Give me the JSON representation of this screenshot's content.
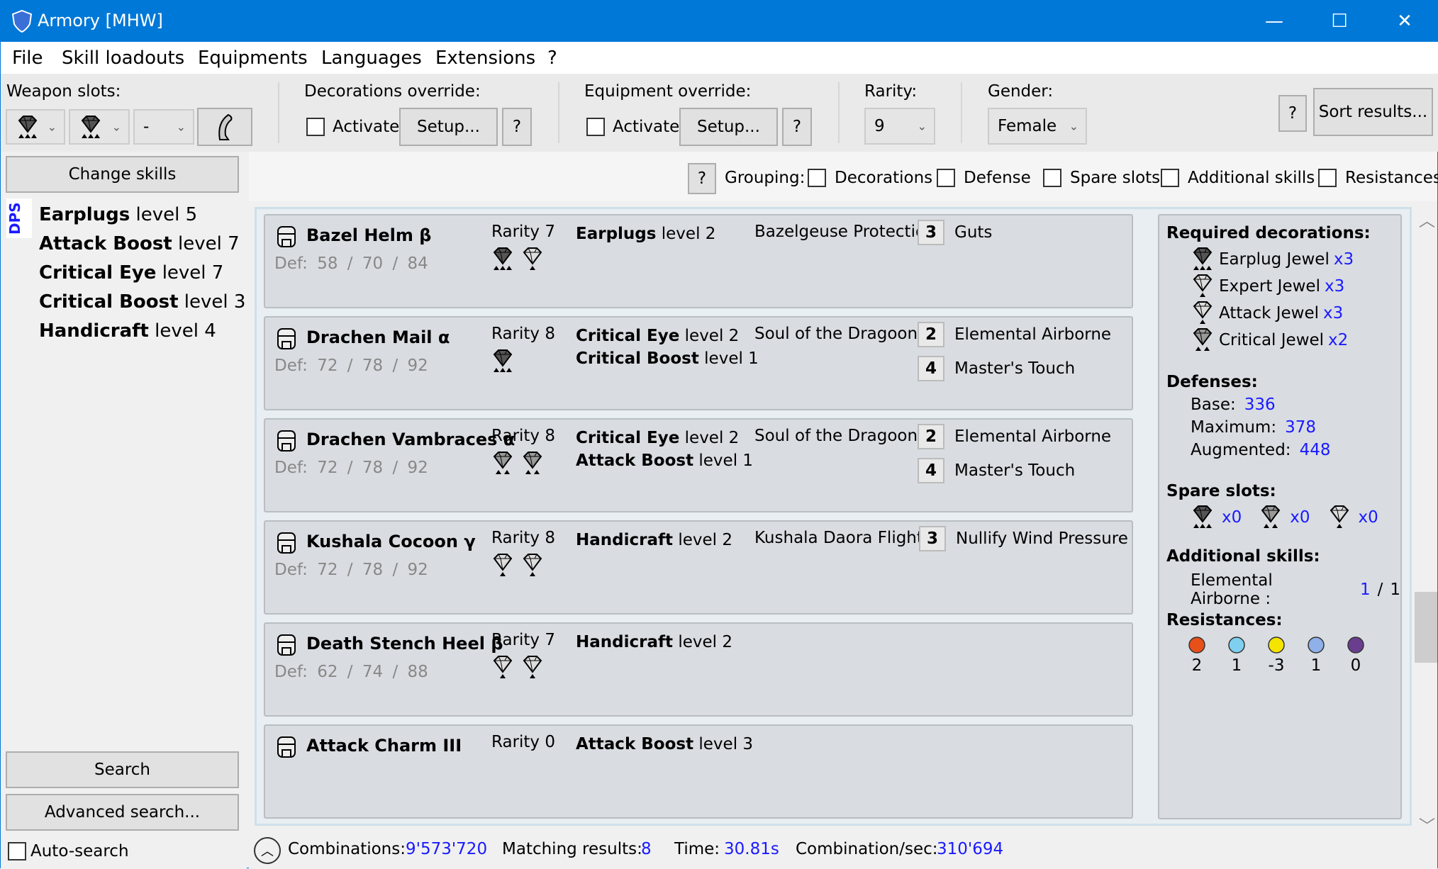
{
  "window": {
    "title": "Armory [MHW]",
    "minimize": "—",
    "maximize": "☐",
    "close": "✕"
  },
  "menu": [
    "File",
    "Skill loadouts",
    "Equipments",
    "Languages",
    "Extensions",
    "?"
  ],
  "toolbar": {
    "weapon_slots_label": "Weapon slots:",
    "weapon_slots": [
      "gem-3",
      "gem-3",
      "-"
    ],
    "decorations_override_label": "Decorations override:",
    "activate_label": "Activate",
    "setup_label": "Setup...",
    "help_label": "?",
    "equipment_override_label": "Equipment override:",
    "rarity_label": "Rarity:",
    "rarity_value": "9",
    "gender_label": "Gender:",
    "gender_value": "Female",
    "sort_label": "Sort results..."
  },
  "left": {
    "change_skills": "Change skills",
    "tab": "DPS",
    "skills": [
      {
        "name": "Earplugs",
        "level": "level 5"
      },
      {
        "name": "Attack Boost",
        "level": "level 7"
      },
      {
        "name": "Critical Eye",
        "level": "level 7"
      },
      {
        "name": "Critical Boost",
        "level": "level 3"
      },
      {
        "name": "Handicraft",
        "level": "level 4"
      }
    ],
    "search": "Search",
    "advanced_search": "Advanced search...",
    "auto_search": "Auto-search"
  },
  "grouping": {
    "help": "?",
    "label": "Grouping:",
    "options": [
      "Decorations",
      "Defense",
      "Spare slots",
      "Additional skills",
      "Resistances"
    ]
  },
  "results": [
    {
      "icon": "helm-icon",
      "name": "Bazel Helm β",
      "def": [
        "Def:",
        "58",
        "/",
        "70",
        "/",
        "84"
      ],
      "rarity": "Rarity 7",
      "gems": [
        3,
        1
      ],
      "skills": [
        {
          "name": "Earplugs",
          "level": "level 2"
        }
      ],
      "set": "Bazelgeuse Protection",
      "bonuses": [
        {
          "rank": "3",
          "skill": "Guts"
        }
      ]
    },
    {
      "icon": "chest-icon",
      "name": "Drachen Mail α",
      "def": [
        "Def:",
        "72",
        "/",
        "78",
        "/",
        "92"
      ],
      "rarity": "Rarity 8",
      "gems": [
        3
      ],
      "skills": [
        {
          "name": "Critical Eye",
          "level": "level 2"
        },
        {
          "name": "Critical Boost",
          "level": "level 1"
        }
      ],
      "set": "Soul of the Dragoon",
      "bonuses": [
        {
          "rank": "2",
          "skill": "Elemental Airborne"
        },
        {
          "rank": "4",
          "skill": "Master's Touch"
        }
      ]
    },
    {
      "icon": "arms-icon",
      "name": "Drachen Vambraces α",
      "def": [
        "Def:",
        "72",
        "/",
        "78",
        "/",
        "92"
      ],
      "rarity": "Rarity 8",
      "gems": [
        2,
        2
      ],
      "skills": [
        {
          "name": "Critical Eye",
          "level": "level 2"
        },
        {
          "name": "Attack Boost",
          "level": "level 1"
        }
      ],
      "set": "Soul of the Dragoon",
      "bonuses": [
        {
          "rank": "2",
          "skill": "Elemental Airborne"
        },
        {
          "rank": "4",
          "skill": "Master's Touch"
        }
      ]
    },
    {
      "icon": "waist-icon",
      "name": "Kushala Cocoon γ",
      "def": [
        "Def:",
        "72",
        "/",
        "78",
        "/",
        "92"
      ],
      "rarity": "Rarity 8",
      "gems": [
        1,
        1
      ],
      "skills": [
        {
          "name": "Handicraft",
          "level": "level 2"
        }
      ],
      "set": "Kushala Daora Flight",
      "bonuses": [
        {
          "rank": "3",
          "skill": "Nullify Wind Pressure"
        }
      ]
    },
    {
      "icon": "legs-icon",
      "name": "Death Stench Heel β",
      "def": [
        "Def:",
        "62",
        "/",
        "74",
        "/",
        "88"
      ],
      "rarity": "Rarity 7",
      "gems": [
        1,
        1
      ],
      "skills": [
        {
          "name": "Handicraft",
          "level": "level 2"
        }
      ],
      "set": "",
      "bonuses": []
    },
    {
      "icon": "charm-icon",
      "name": "Attack Charm III",
      "def": [],
      "rarity": "Rarity 0",
      "gems": [],
      "skills": [
        {
          "name": "Attack Boost",
          "level": "level 3"
        }
      ],
      "set": "",
      "bonuses": []
    }
  ],
  "summary": {
    "required_label": "Required decorations:",
    "decorations": [
      {
        "gem": 3,
        "name": "Earplug Jewel",
        "count": "x3"
      },
      {
        "gem": 1,
        "name": "Expert Jewel",
        "count": "x3"
      },
      {
        "gem": 1,
        "name": "Attack Jewel",
        "count": "x3"
      },
      {
        "gem": 2,
        "name": "Critical Jewel",
        "count": "x2"
      }
    ],
    "defenses_label": "Defenses:",
    "base_label": "Base:",
    "base": "336",
    "max_label": "Maximum:",
    "max": "378",
    "aug_label": "Augmented:",
    "aug": "448",
    "spare_label": "Spare slots:",
    "spare": [
      {
        "gem": 3,
        "count": "x0"
      },
      {
        "gem": 2,
        "count": "x0"
      },
      {
        "gem": 1,
        "count": "x0"
      }
    ],
    "additional_label": "Additional skills:",
    "additional": [
      {
        "name": "Elemental Airborne :",
        "current": "1",
        "sep": "/",
        "max": "1"
      }
    ],
    "resist_label": "Resistances:",
    "resistances": [
      {
        "icon": "fire",
        "value": "2",
        "color": "#e8501a"
      },
      {
        "icon": "water",
        "value": "1",
        "color": "#7fd0f0"
      },
      {
        "icon": "thunder",
        "value": "-3",
        "color": "#f5e400"
      },
      {
        "icon": "ice",
        "value": "1",
        "color": "#8fb0e8"
      },
      {
        "icon": "dragon",
        "value": "0",
        "color": "#6a3d8f"
      }
    ]
  },
  "status": {
    "combinations_label": "Combinations:",
    "combinations": "9'573'720",
    "matching_label": "Matching results:",
    "matching": "8",
    "time_label": "Time:",
    "time": "30.81s",
    "rate_label": "Combination/sec:",
    "rate": "310'694"
  }
}
